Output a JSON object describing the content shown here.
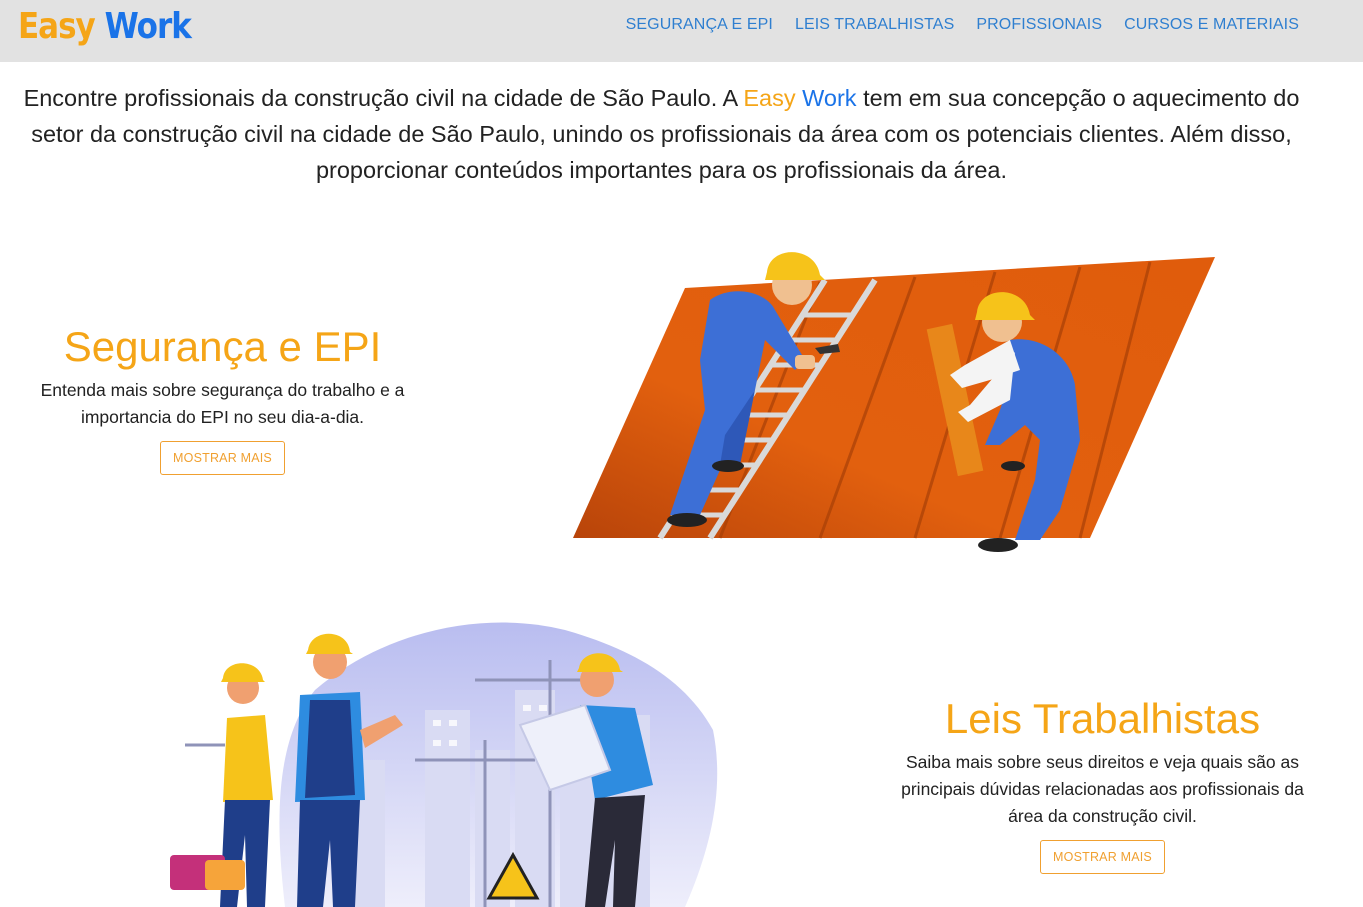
{
  "brand": {
    "easy": "Easy",
    "work": "Work"
  },
  "nav": {
    "items": [
      {
        "label": "SEGURANÇA E EPI"
      },
      {
        "label": "LEIS TRABALHISTAS"
      },
      {
        "label": "PROFISSIONAIS"
      },
      {
        "label": "CURSOS E MATERIAIS"
      }
    ]
  },
  "intro": {
    "part1": "Encontre profissionais da construção civil na cidade de São Paulo. A ",
    "easy": "Easy",
    "work": "Work",
    "part2": " tem em sua concepção o aquecimento do setor da construção civil na cidade de São Paulo, unindo os profissionais da área com os potenciais clientes. Além disso, proporcionar conteúdos importantes para os profissionais da área."
  },
  "sections": [
    {
      "title": "Segurança e EPI",
      "description": "Entenda mais sobre segurança do trabalho e a importancia do EPI no seu dia-a-dia.",
      "button": "MOSTRAR MAIS"
    },
    {
      "title": "Leis Trabalhistas",
      "description": "Saiba mais sobre seus direitos e veja quais são as principais dúvidas relacionadas aos profissionais da área da construção civil.",
      "button": "MOSTRAR MAIS"
    }
  ],
  "colors": {
    "accent": "#f5a517",
    "brand_blue": "#1a73e8",
    "nav_link": "#2f7fd0",
    "navbar_bg": "#e2e2e2",
    "roof": "#d95a0a"
  },
  "illustrations": [
    "roofers-illustration",
    "construction-team-illustration"
  ]
}
